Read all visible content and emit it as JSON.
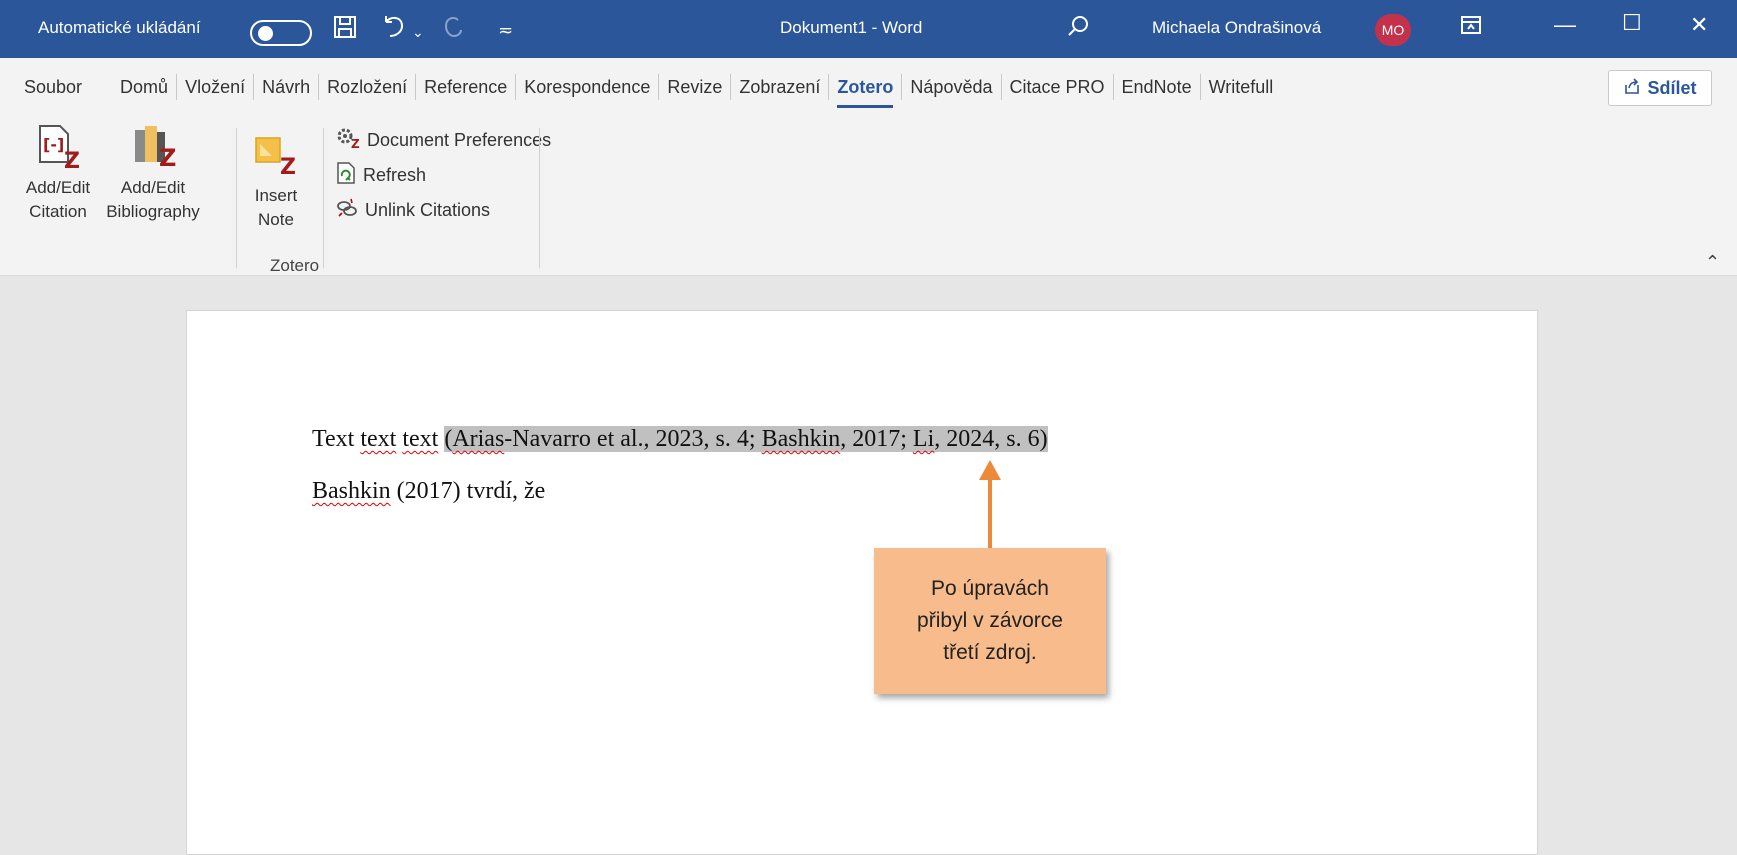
{
  "titlebar": {
    "autosave_label": "Automatické ukládání",
    "document_title": "Dokument1  -  Word",
    "user_name": "Michaela Ondrašinová",
    "user_initials": "MO",
    "color": "#2b579a"
  },
  "tabs": [
    "Soubor",
    "Domů",
    "Vložení",
    "Návrh",
    "Rozložení",
    "Reference",
    "Korespondence",
    "Revize",
    "Zobrazení",
    "Zotero",
    "Nápověda",
    "Citace PRO",
    "EndNote",
    "Writefull"
  ],
  "active_tab": "Zotero",
  "share_label": "Sdílet",
  "ribbon": {
    "add_edit_citation": "Add/Edit Citation",
    "add_edit_citation_l1": "Add/Edit",
    "add_edit_citation_l2": "Citation",
    "add_edit_bibliography_l1": "Add/Edit",
    "add_edit_bibliography_l2": "Bibliography",
    "insert_note_l1": "Insert",
    "insert_note_l2": "Note",
    "document_preferences": "Document Preferences",
    "refresh": "Refresh",
    "unlink_citations": "Unlink Citations",
    "group_label": "Zotero"
  },
  "document": {
    "line1_prefix": "Text ",
    "line1_w1": "text",
    "line1_sp": " ",
    "line1_w2": "text",
    "line1_sp2": " ",
    "citation": {
      "p1": "(",
      "a1": "Arias",
      "p2": "-Navarro et al., 2023, s. 4; ",
      "a2": "Bashkin",
      "p3": ", 2017; ",
      "a3": "Li",
      "p4": ", 2024, s. 6)"
    },
    "line2_name": "Bashkin",
    "line2_rest": " (2017) tvrdí, že"
  },
  "annotation": {
    "text": "Po úpravách\npřibyl v závorce\ntřetí zdroj.",
    "box_color": "#f8bc8c",
    "arrow_color": "#ed8a3a"
  }
}
